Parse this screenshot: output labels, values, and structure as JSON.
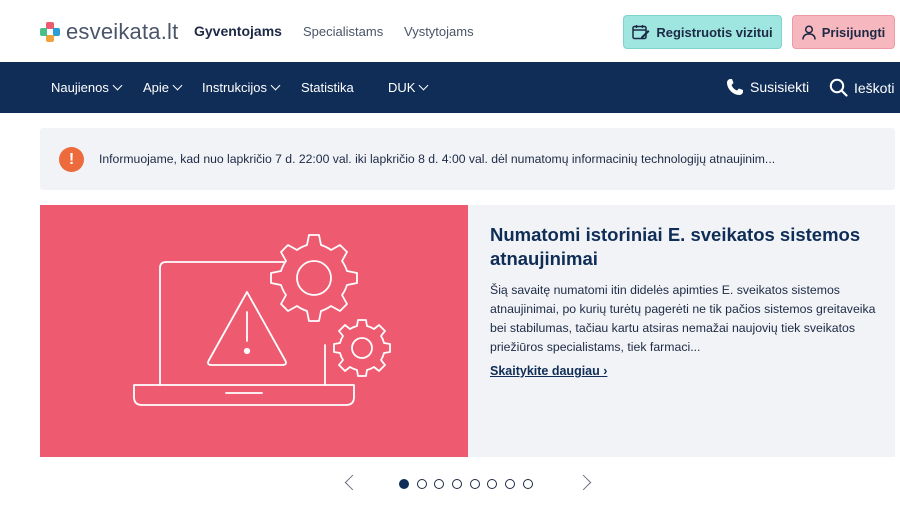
{
  "header": {
    "logo_text": "esveikata.lt",
    "nav": [
      "Gyventojams",
      "Specialistams",
      "Vystytojams"
    ],
    "register_label": "Registruotis vizitui",
    "login_label": "Prisijungti"
  },
  "mainnav": {
    "items": [
      {
        "label": "Naujienos",
        "dropdown": true
      },
      {
        "label": "Apie",
        "dropdown": true
      },
      {
        "label": "Instrukcijos",
        "dropdown": true
      },
      {
        "label": "Statistika",
        "dropdown": false
      },
      {
        "label": "DUK",
        "dropdown": true
      }
    ],
    "contact_label": "Susisiekti",
    "search_label": "Ieškoti"
  },
  "notice": {
    "icon": "!",
    "text": "Informuojame, kad nuo lapkričio 7 d. 22:00 val. iki lapkričio 8 d. 4:00 val. dėl numatomų informacinių technologijų atnaujinim..."
  },
  "slide": {
    "title": "Numatomi istoriniai E. sveikatos sistemos atnaujinimai",
    "body": "Šią savaitę numatomi itin didelės apimties E. sveikatos sistemos atnaujinimai, po kurių turėtų pagerėti ne tik pačios sistemos greitaveika bei stabilumas, tačiau kartu atsiras nemažai naujovių tiek sveikatos priežiūros specialistams, tiek farmaci...",
    "link": "Skaitykite daugiau ›"
  },
  "carousel": {
    "total": 8,
    "active_index": 0
  },
  "colors": {
    "navy": "#0f2d57",
    "teal_button": "#9fe5e0",
    "pink_button": "#f7b7bf",
    "slide_red": "#ee5a70",
    "notice_orange": "#ed6a3c"
  }
}
